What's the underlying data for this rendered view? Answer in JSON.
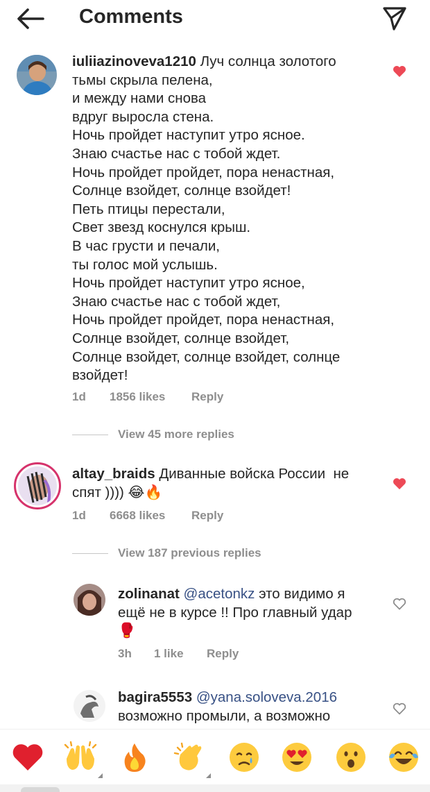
{
  "header": {
    "title": "Comments"
  },
  "comments": [
    {
      "username": "iuliiazinoveva1210",
      "text": " Луч солнца золотого\nтьмы скрыла пелена,\nи между нами снова\nвдруг выросла стена.\nНочь пройдет наступит утро ясное.\nЗнаю счастье нас с тобой ждет.\nНочь пройдет пройдет, пора ненастная,\nСолнце взойдет, солнце взойдет!\nПеть птицы перестали,\nСвет звезд коснулся крыш.\nВ час грусти и печали,\nты голос мой услышь.\nНочь пройдет наступит утро ясное,\nЗнаю счастье нас с тобой ждет,\nНочь пройдет пройдет, пора ненастная,\nСолнце взойдет, солнце взойдет,\nСолнце взойдет, солнце взойдет, солнце\nвзойдет!",
      "time": "1d",
      "likes": "1856 likes",
      "reply": "Reply",
      "liked": true
    },
    {
      "username": "altay_braids",
      "text": " Диванные войска России  не\nспят )))) 😂🔥",
      "time": "1d",
      "likes": "6668 likes",
      "reply": "Reply",
      "liked": true
    },
    {
      "username": "zolinanat",
      "mention": "@acetonkz",
      "text": " это видимо я\nещё не в курсе !! Про главный удар\n🥊",
      "time": "3h",
      "likes": "1 like",
      "reply": "Reply",
      "liked": false
    },
    {
      "username": "bagira5553",
      "mention": "@yana.soloveva.2016",
      "text": "\nвозможно промыли, а возможно",
      "liked": false
    }
  ],
  "view_more_1": "View 45 more replies",
  "view_more_2": "View 187 previous replies",
  "emojis": [
    "❤️",
    "🙌",
    "🔥",
    "👏",
    "😢",
    "😍",
    "😮",
    "😂"
  ],
  "colors": {
    "like_red": "#ed4956",
    "muted": "#8e8e8e",
    "mention": "#385185"
  }
}
